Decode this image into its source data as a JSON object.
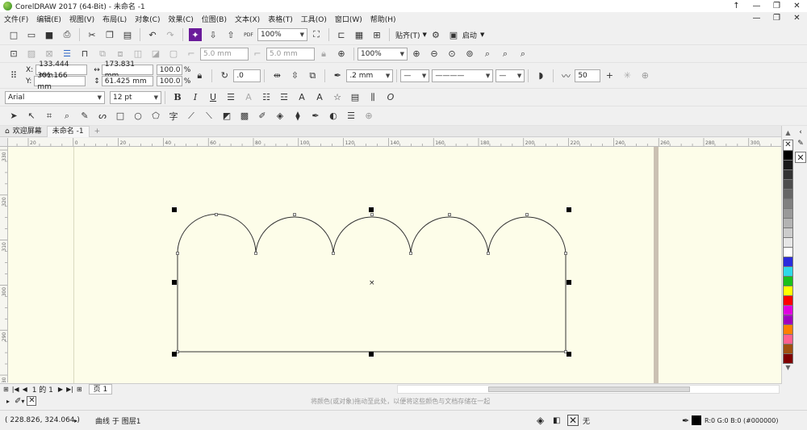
{
  "window": {
    "title": "CorelDRAW 2017 (64-Bit) - 未命名 -1",
    "controls": [
      "↑",
      "—",
      "❐",
      "✕"
    ]
  },
  "menu": {
    "items": [
      "文件(F)",
      "编辑(E)",
      "视图(V)",
      "布局(L)",
      "对象(C)",
      "效果(C)",
      "位图(B)",
      "文本(X)",
      "表格(T)",
      "工具(O)",
      "窗口(W)",
      "帮助(H)"
    ],
    "right_controls": [
      "—",
      "❐",
      "✕"
    ]
  },
  "standard_toolbar": {
    "zoom_value": "100%",
    "snap_label": "贴齐(T)",
    "launch_label": "启动",
    "pdf_label": "PDF"
  },
  "secondary_toolbar": {
    "size_a": "5.0 mm",
    "size_b": "5.0 mm",
    "zoom_value": "100%"
  },
  "property_bar": {
    "x_label": "X:",
    "x_value": "133.444 mm",
    "y_label": "Y:",
    "y_value": "301.166 mm",
    "width_value": "173.831 mm",
    "height_value": "61.425 mm",
    "scale_w": "100.0",
    "scale_h": "100.0",
    "percent": "%",
    "rotation": ".0",
    "outline_width": ".2 mm",
    "smoothing": "50"
  },
  "text_toolbar": {
    "font_name": "Arial",
    "font_size": "12 pt"
  },
  "document_tabs": [
    {
      "label": "欢迎屏幕",
      "active": false
    },
    {
      "label": "未命名 -1",
      "active": true
    }
  ],
  "ruler": {
    "h_ticks": [
      "20",
      "0",
      "20",
      "40",
      "60",
      "80",
      "100",
      "120",
      "140",
      "160",
      "180",
      "200",
      "220",
      "240",
      "260",
      "280",
      "300"
    ],
    "v_ticks": [
      "330",
      "320",
      "310",
      "300",
      "290",
      "280"
    ]
  },
  "palette": {
    "colors": [
      "#000000",
      "#1a1a1a",
      "#333333",
      "#4d4d4d",
      "#666666",
      "#808080",
      "#999999",
      "#b3b3b3",
      "#cccccc",
      "#e6e6e6",
      "#ffffff",
      "#2b2bdc",
      "#2fd8e8",
      "#1bc01b",
      "#ffff00",
      "#ff0000",
      "#e000e0",
      "#a000c0",
      "#ff8000",
      "#ff6090",
      "#a05010",
      "#800000"
    ]
  },
  "page_nav": {
    "page_of": "1 的 1",
    "page_tab": "页 1"
  },
  "hint_text": "将颜色(或对象)拖动至此处，以便将这些颜色与文档存储在一起",
  "status": {
    "coords": "( 228.826, 324.064 )",
    "object_info": "曲线 于 图层1",
    "fill_none": "无",
    "outline_color": "R:0 G:0 B:0 (#000000)"
  },
  "colors": {
    "canvas": "#fdfde9",
    "page_border": "#cbc1b3",
    "accent": "#6a1b9a"
  }
}
